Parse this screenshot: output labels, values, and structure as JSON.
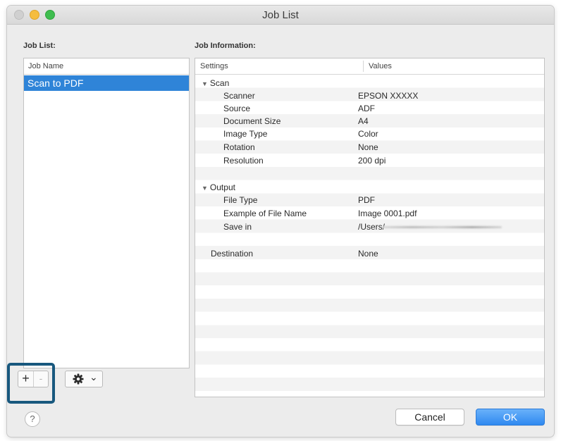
{
  "window": {
    "title": "Job List"
  },
  "job_list": {
    "label": "Job List:",
    "column_header": "Job Name",
    "items": [
      {
        "label": "Scan to PDF",
        "selected": true
      }
    ]
  },
  "job_info": {
    "label": "Job Information:",
    "col_settings": "Settings",
    "col_values": "Values",
    "rows": [
      {
        "kind": "group",
        "setting": "Scan",
        "value": ""
      },
      {
        "kind": "item",
        "setting": "Scanner",
        "value": "EPSON XXXXX"
      },
      {
        "kind": "item",
        "setting": "Source",
        "value": "ADF"
      },
      {
        "kind": "item",
        "setting": "Document Size",
        "value": "A4"
      },
      {
        "kind": "item",
        "setting": "Image Type",
        "value": "Color"
      },
      {
        "kind": "item",
        "setting": "Rotation",
        "value": "None"
      },
      {
        "kind": "item",
        "setting": "Resolution",
        "value": "200 dpi"
      },
      {
        "kind": "blank",
        "setting": "",
        "value": ""
      },
      {
        "kind": "group",
        "setting": "Output",
        "value": ""
      },
      {
        "kind": "item",
        "setting": "File Type",
        "value": "PDF"
      },
      {
        "kind": "item",
        "setting": "Example of File Name",
        "value": "Image 0001.pdf"
      },
      {
        "kind": "item",
        "setting": "Save in",
        "value": "/Users/"
      },
      {
        "kind": "blank",
        "setting": "",
        "value": ""
      },
      {
        "kind": "top",
        "setting": "Destination",
        "value": "None"
      }
    ]
  },
  "toolbar": {
    "add_label": "+",
    "remove_label": "-",
    "settings_chevron": "⌄"
  },
  "help": {
    "label": "?"
  },
  "buttons": {
    "cancel": "Cancel",
    "ok": "OK"
  },
  "icons": {
    "disclosure": "disclosure-triangle-icon",
    "settings": "gear-icon",
    "help": "question-mark-icon"
  }
}
